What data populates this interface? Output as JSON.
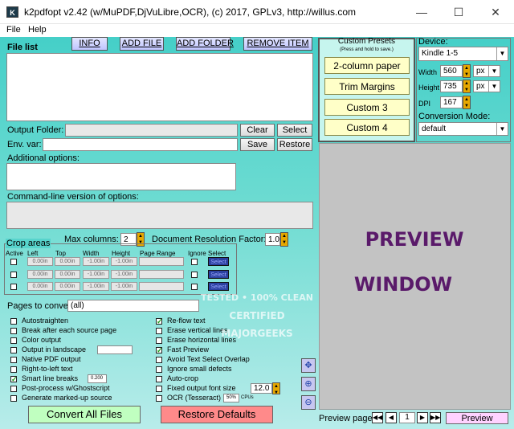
{
  "window": {
    "icon_text": "K",
    "title": "k2pdfopt v2.42 (w/MuPDF,DjVuLibre,OCR), (c) 2017, GPLv3, http://willus.com",
    "minimize": "—",
    "maximize": "☐",
    "close": "✕"
  },
  "menu": {
    "file": "File",
    "help": "Help"
  },
  "file_list": {
    "label": "File list",
    "info": "INFO",
    "add_file": "ADD FILE",
    "add_folder": "ADD FOLDER",
    "remove_item": "REMOVE ITEM"
  },
  "output": {
    "label": "Output Folder:",
    "value": "",
    "clear": "Clear",
    "select": "Select"
  },
  "env": {
    "label": "Env. var:",
    "value": "",
    "save": "Save",
    "restore": "Restore"
  },
  "additional": {
    "label": "Additional options:",
    "value": ""
  },
  "cmdline": {
    "label": "Command-line version of options:",
    "value": ""
  },
  "crop": {
    "title": "Crop areas",
    "headers": {
      "active": "Active",
      "left": "Left",
      "top": "Top",
      "width": "Width",
      "height": "Height",
      "page_range": "Page Range",
      "ignore": "Ignore",
      "select": "Select"
    },
    "rows": [
      {
        "left": "0.00in",
        "top": "0.00in",
        "width": "-1.00in",
        "height": "-1.00in",
        "select": "Select"
      },
      {
        "left": "0.00in",
        "top": "0.00in",
        "width": "-1.00in",
        "height": "-1.00in",
        "select": "Select"
      },
      {
        "left": "0.00in",
        "top": "0.00in",
        "width": "-1.00in",
        "height": "-1.00in",
        "select": "Select"
      }
    ]
  },
  "max_columns": {
    "label": "Max columns:",
    "value": "2"
  },
  "doc_res": {
    "label": "Document Resolution Factor:",
    "value": "1.0"
  },
  "pages": {
    "label": "Pages to convert:",
    "value": "(all)"
  },
  "options_left": [
    {
      "label": "Autostraighten",
      "checked": false
    },
    {
      "label": "Break after each source page",
      "checked": false
    },
    {
      "label": "Color output",
      "checked": false
    },
    {
      "label": "Output in landscape",
      "checked": false
    },
    {
      "label": "Native PDF output",
      "checked": false
    },
    {
      "label": "Right-to-left text",
      "checked": false
    },
    {
      "label": "Smart line breaks",
      "checked": true
    },
    {
      "label": "Post-process w/Ghostscript",
      "checked": false
    },
    {
      "label": "Generate marked-up source",
      "checked": false
    }
  ],
  "smart_line_value": "0.200",
  "options_right": [
    {
      "label": "Re-flow text",
      "checked": true
    },
    {
      "label": "Erase vertical lines",
      "checked": false
    },
    {
      "label": "Erase horizontal lines",
      "checked": false
    },
    {
      "label": "Fast Preview",
      "checked": true
    },
    {
      "label": "Avoid Text Select Overlap",
      "checked": false
    },
    {
      "label": "Ignore small defects",
      "checked": false
    },
    {
      "label": "Auto-crop",
      "checked": false
    },
    {
      "label": "Fixed output font size",
      "checked": false
    },
    {
      "label": "OCR (Tesseract)",
      "checked": false
    }
  ],
  "font_size_value": "12.0",
  "ocr_value": "50%",
  "ocr_unit": "CPUs",
  "convert_all": "Convert All Files",
  "restore_defaults": "Restore Defaults",
  "presets": {
    "title": "Custom Presets",
    "subtitle": "(Press and hold to save.)",
    "items": [
      "2-column paper",
      "Trim Margins",
      "Custom 3",
      "Custom 4"
    ]
  },
  "device": {
    "label": "Device:",
    "value": "Kindle 1-5",
    "width_label": "Width",
    "width_value": "560",
    "width_unit": "px",
    "height_label": "Height",
    "height_value": "735",
    "height_unit": "px",
    "dpi_label": "DPI",
    "dpi_value": "167"
  },
  "conversion": {
    "label": "Conversion Mode:",
    "value": "default"
  },
  "preview": {
    "line1": "PREVIEW",
    "line2": "WINDOW",
    "page_label": "Preview page:",
    "page_value": "1",
    "button": "Preview"
  },
  "watermark": {
    "line1": "TESTED • 100% CLEAN",
    "line2": "CERTIFIED",
    "line3": "MAJORGEEKS"
  },
  "icons": {
    "first": "◀◀",
    "prev": "◀",
    "next": "▶",
    "last": "▶▶",
    "move": "✥",
    "zoom_in": "⊕",
    "zoom_out": "⊖",
    "check": "✓",
    "dropdown": "▼",
    "spin_up": "▲",
    "spin_down": "▼"
  },
  "colors": {
    "background_top": "#45cfc8",
    "preview_text": "#5a1a6a",
    "preset_yellow": "#ffffc8",
    "convert_green": "#c0ffc0",
    "restore_red": "#ff8a8a"
  }
}
